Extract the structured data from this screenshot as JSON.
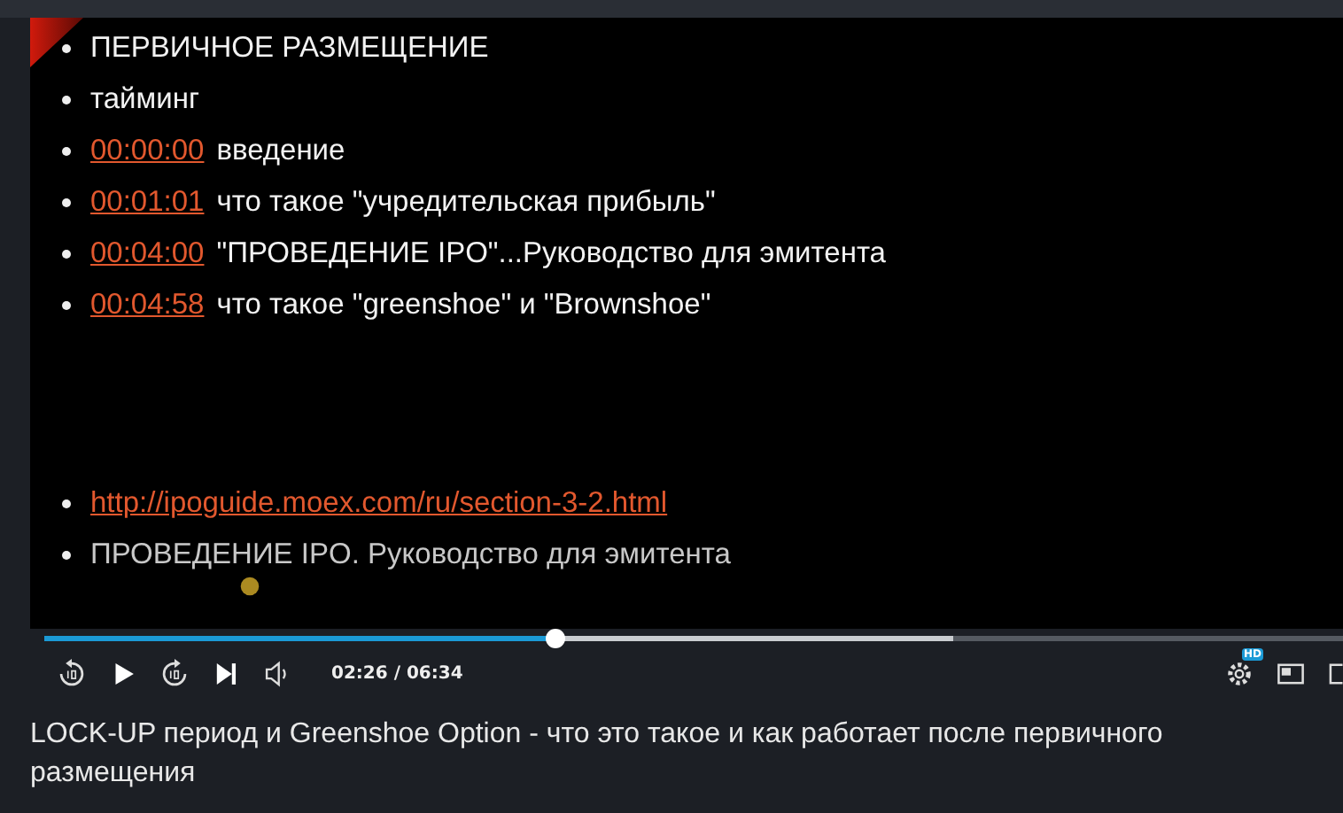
{
  "slide": {
    "lines": [
      {
        "kind": "text",
        "text": "ПЕРВИЧНОЕ РАЗМЕЩЕНИЕ"
      },
      {
        "kind": "text",
        "text": "тайминг"
      },
      {
        "kind": "timecode",
        "time": "00:00:00",
        "text": "введение"
      },
      {
        "kind": "timecode",
        "time": "00:01:01",
        "text": "что такое \"учредительская прибыль\""
      },
      {
        "kind": "timecode",
        "time": "00:04:00",
        "text": "\"ПРОВЕДЕНИЕ IPO\"...Руководство для эмитента"
      },
      {
        "kind": "timecode",
        "time": "00:04:58",
        "text": "что такое \"greenshoe\" и \"Brownshoe\""
      },
      {
        "kind": "spacer"
      },
      {
        "kind": "link",
        "text": "http://ipoguide.moex.com/ru/section-3-2.html"
      },
      {
        "kind": "muted",
        "text": "ПРОВЕДЕНИЕ IPO. Руководство для эмитента"
      }
    ]
  },
  "progress": {
    "level": 0.394,
    "buffered": {
      "level": 0.7
    }
  },
  "time": "02:26 / 06:34",
  "settings_badge": "HD",
  "video_title": "LOCK-UP период и Greenshoe Option - что это такое и как работает после первичного размещения"
}
